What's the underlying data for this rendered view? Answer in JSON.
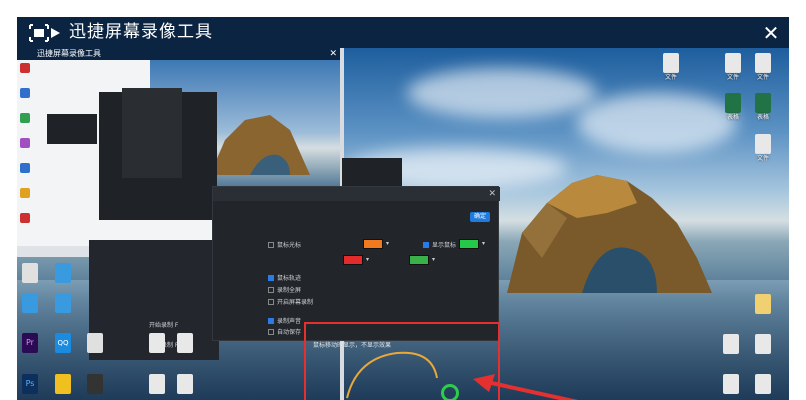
{
  "app": {
    "title": "迅捷屏幕录像工具",
    "close_glyph": "✕"
  },
  "nested": {
    "title": "迅捷屏幕录像工具",
    "close_glyph": "✕"
  },
  "desktop_right_icons": [
    {
      "label": "文件",
      "color": "#e8e8e8"
    },
    {
      "label": "文件",
      "color": "#e8e8e8"
    },
    {
      "label": "文件",
      "color": "#e8e8e8"
    },
    {
      "label": "表格",
      "color": "#217346"
    },
    {
      "label": "表格",
      "color": "#217346"
    },
    {
      "label": "文件",
      "color": "#e8e8e8"
    }
  ],
  "desktop_left_icons": [
    {
      "label": "Pr",
      "color": "#2b0b54"
    },
    {
      "label": "Ps",
      "color": "#0d2f5c"
    },
    {
      "label": "QQ",
      "color": "#1b8be0"
    }
  ],
  "dialog": {
    "button_label": "确定",
    "close_glyph": "✕",
    "options": [
      {
        "label": "鼠标光标",
        "on": false
      },
      {
        "label": "显示鼠标",
        "on": true
      },
      {
        "label": "鼠标轨迹",
        "on": true
      },
      {
        "label": "录制声音",
        "on": true
      },
      {
        "label": "开启屏幕录制",
        "on": false
      },
      {
        "label": "录制全屏",
        "on": false
      },
      {
        "label": "自动保存",
        "on": false
      }
    ],
    "swatch_colors": [
      "#f07a20",
      "#26c84a",
      "#e32b2b",
      "#3ab04a"
    ]
  },
  "hotkeys": {
    "start": "开始录制 F",
    "stop": "停止录制 F"
  },
  "tip": "鼠标移动时显示，不显示效果"
}
